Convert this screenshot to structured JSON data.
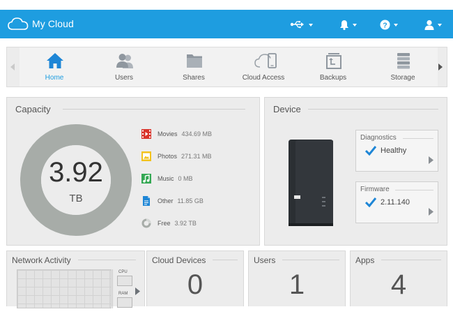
{
  "header": {
    "app_title": "My Cloud",
    "bg_color": "#1e9de0",
    "buttons": [
      {
        "name": "usb-icon"
      },
      {
        "name": "bell-icon"
      },
      {
        "name": "help-icon"
      },
      {
        "name": "user-icon"
      }
    ]
  },
  "nav": {
    "items": [
      {
        "label": "Home",
        "icon": "home-icon",
        "active": true
      },
      {
        "label": "Users",
        "icon": "users-icon"
      },
      {
        "label": "Shares",
        "icon": "folder-icon"
      },
      {
        "label": "Cloud Access",
        "icon": "cloud-access-icon"
      },
      {
        "label": "Backups",
        "icon": "backups-icon"
      },
      {
        "label": "Storage",
        "icon": "storage-icon"
      }
    ]
  },
  "capacity": {
    "title": "Capacity",
    "total_value": "3.92",
    "total_unit": "TB",
    "legend": [
      {
        "label": "Movies",
        "value": "434.69 MB",
        "icon": "movies-icon",
        "color": "#d9342b"
      },
      {
        "label": "Photos",
        "value": "271.31 MB",
        "icon": "photos-icon",
        "color": "#f2c21c"
      },
      {
        "label": "Music",
        "value": "0 MB",
        "icon": "music-icon",
        "color": "#34a853"
      },
      {
        "label": "Other",
        "value": "11.85 GB",
        "icon": "other-icon",
        "color": "#1e86d6"
      },
      {
        "label": "Free",
        "value": "3.92 TB",
        "icon": "free-icon",
        "color": "#a7aca8"
      }
    ]
  },
  "device": {
    "title": "Device",
    "diagnostics": {
      "title": "Diagnostics",
      "status": "Healthy"
    },
    "firmware": {
      "title": "Firmware",
      "version": "2.11.140"
    }
  },
  "bottom": {
    "network": {
      "title": "Network Activity",
      "cpu_label": "CPU",
      "ram_label": "RAM"
    },
    "cloud_devices": {
      "title": "Cloud Devices",
      "count": "0"
    },
    "users": {
      "title": "Users",
      "count": "1"
    },
    "apps": {
      "title": "Apps",
      "count": "4"
    }
  }
}
